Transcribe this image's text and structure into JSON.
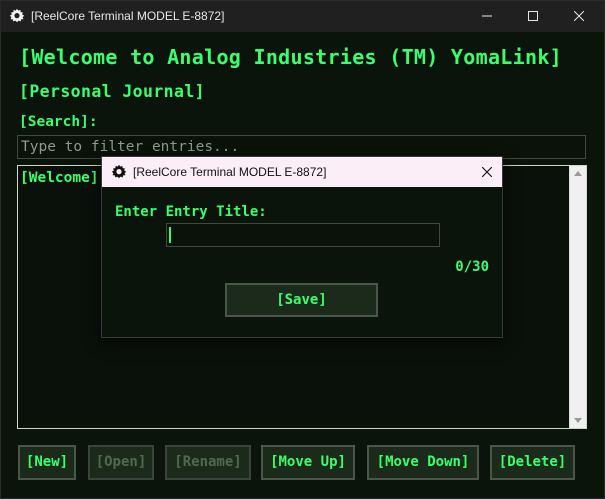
{
  "window": {
    "title": "[ReelCore Terminal MODEL E-8872]"
  },
  "header": {
    "title": "[Welcome to Analog Industries (TM) YomaLink]",
    "subtitle": "[Personal Journal]"
  },
  "search": {
    "label": "[Search]:",
    "placeholder": "Type to filter entries...",
    "value": ""
  },
  "entries": [
    {
      "title": "[Welcome]"
    }
  ],
  "toolbar": {
    "new_label": "[New]",
    "open_label": "[Open]",
    "rename_label": "[Rename]",
    "move_up_label": "[Move Up]",
    "move_down_label": "[Move Down]",
    "delete_label": "[Delete]"
  },
  "dialog": {
    "title": "[ReelCore Terminal MODEL E-8872]",
    "prompt": "Enter Entry Title:",
    "value": "",
    "counter": "0/30",
    "save_label": "[Save]"
  },
  "colors": {
    "accent": "#39ff6e",
    "background": "#0b140b",
    "disabled": "#4e6a4e"
  },
  "icons": {
    "app": "gear-icon",
    "minimize": "minimize-icon",
    "maximize": "maximize-icon",
    "close": "close-icon"
  }
}
